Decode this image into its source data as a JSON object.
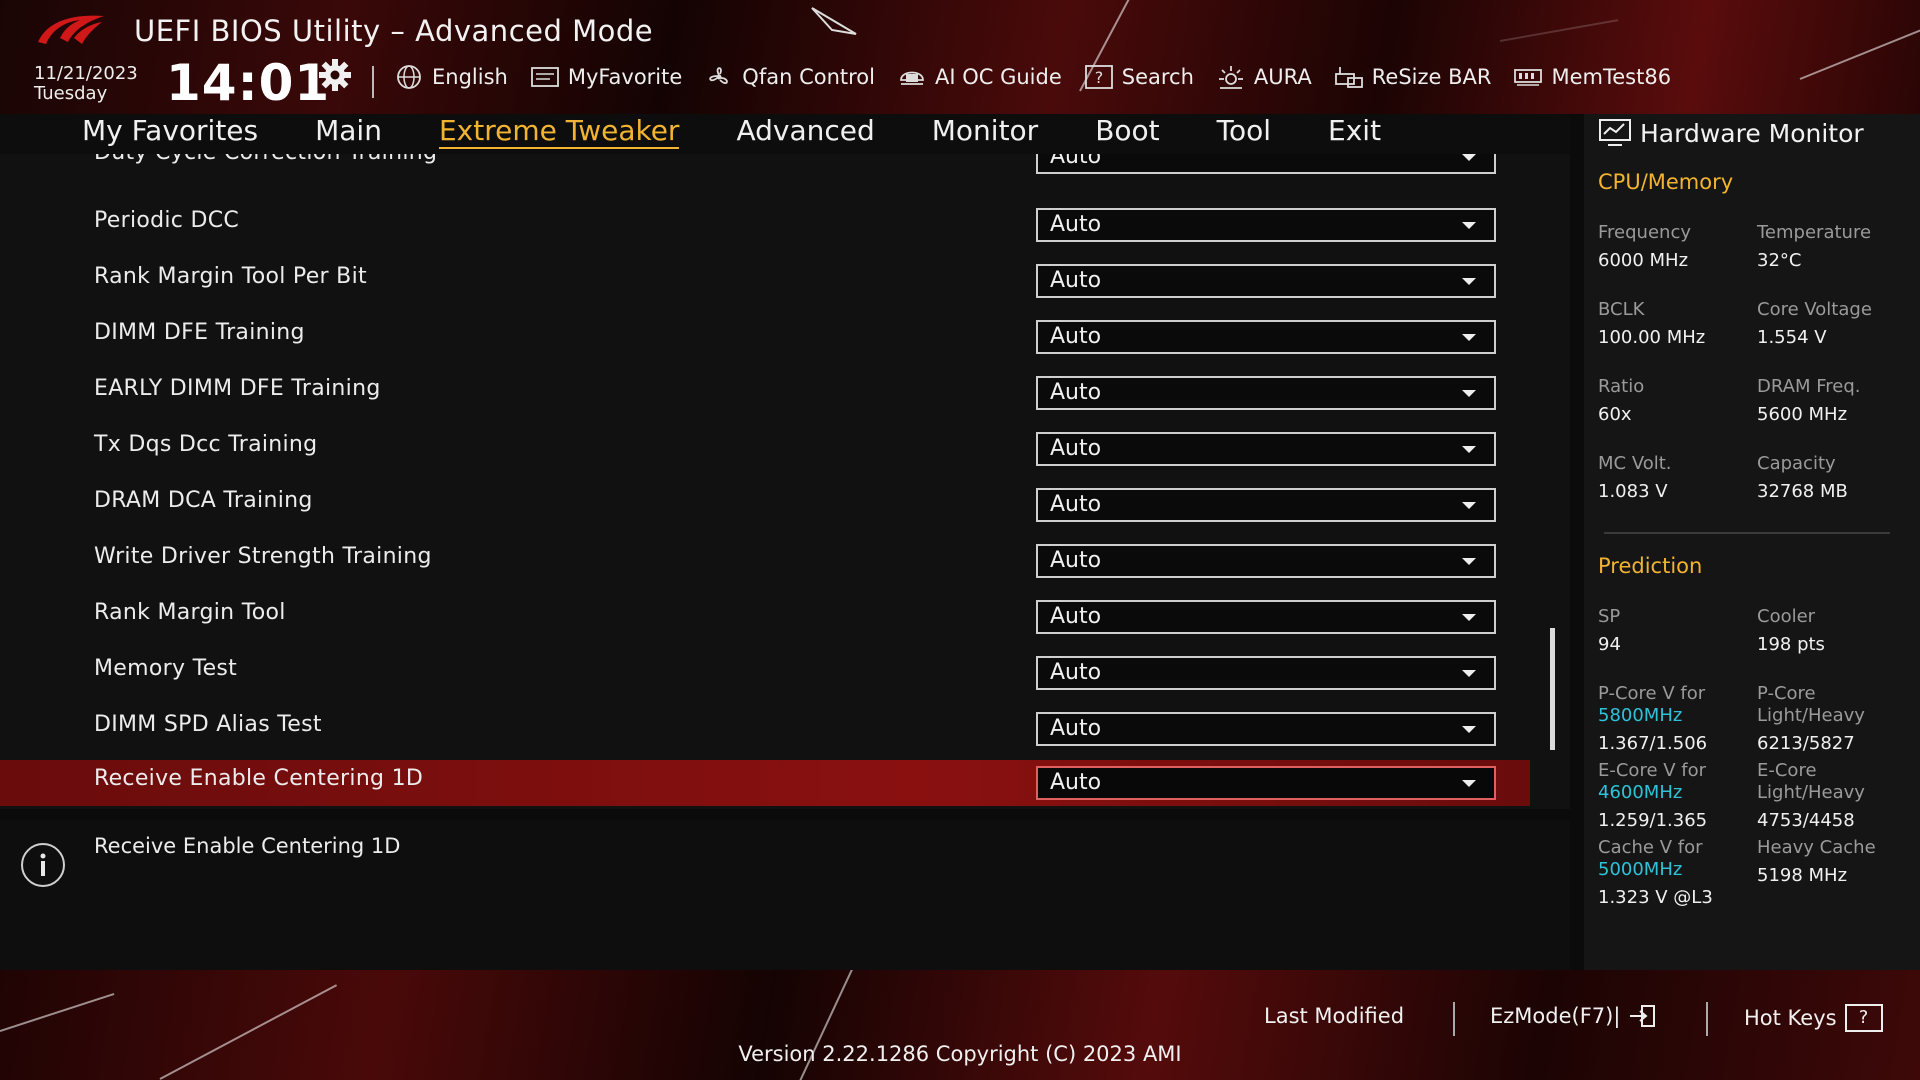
{
  "header": {
    "title": "UEFI BIOS Utility – Advanced Mode",
    "date": "11/21/2023",
    "day": "Tuesday",
    "time": "14:01",
    "tools": [
      {
        "label": "English",
        "icon": "globe-icon"
      },
      {
        "label": "MyFavorite",
        "icon": "favorite-icon"
      },
      {
        "label": "Qfan Control",
        "icon": "fan-icon"
      },
      {
        "label": "AI OC Guide",
        "icon": "ai-icon"
      },
      {
        "label": "Search",
        "icon": "search-icon"
      },
      {
        "label": "AURA",
        "icon": "aura-icon"
      },
      {
        "label": "ReSize BAR",
        "icon": "resize-bar-icon"
      },
      {
        "label": "MemTest86",
        "icon": "memtest-icon"
      }
    ]
  },
  "menu": {
    "tabs": [
      "My Favorites",
      "Main",
      "Extreme Tweaker",
      "Advanced",
      "Monitor",
      "Boot",
      "Tool",
      "Exit"
    ],
    "active": "Extreme Tweaker"
  },
  "settings": {
    "partial_row": {
      "label": "Duty Cycle Correction Training",
      "value": "Auto"
    },
    "rows": [
      {
        "label": "Periodic DCC",
        "value": "Auto"
      },
      {
        "label": "Rank Margin Tool Per Bit",
        "value": "Auto"
      },
      {
        "label": "DIMM DFE Training",
        "value": "Auto"
      },
      {
        "label": "EARLY DIMM DFE Training",
        "value": "Auto"
      },
      {
        "label": "Tx Dqs Dcc Training",
        "value": "Auto"
      },
      {
        "label": "DRAM DCA Training",
        "value": "Auto"
      },
      {
        "label": "Write Driver Strength Training",
        "value": "Auto"
      },
      {
        "label": "Rank Margin Tool",
        "value": "Auto"
      },
      {
        "label": "Memory Test",
        "value": "Auto"
      },
      {
        "label": "DIMM SPD Alias Test",
        "value": "Auto"
      },
      {
        "label": "Receive Enable Centering 1D",
        "value": "Auto"
      }
    ],
    "selected_index": 10
  },
  "info": {
    "text": "Receive Enable Centering 1D"
  },
  "hardware_monitor": {
    "title": "Hardware Monitor",
    "cpu_section": "CPU/Memory",
    "cpu": [
      {
        "k": "Frequency",
        "v": "6000 MHz"
      },
      {
        "k": "Temperature",
        "v": "32°C"
      },
      {
        "k": "BCLK",
        "v": "100.00 MHz"
      },
      {
        "k": "Core Voltage",
        "v": "1.554 V"
      },
      {
        "k": "Ratio",
        "v": "60x"
      },
      {
        "k": "DRAM Freq.",
        "v": "5600 MHz"
      },
      {
        "k": "MC Volt.",
        "v": "1.083 V"
      },
      {
        "k": "Capacity",
        "v": "32768 MB"
      }
    ],
    "prediction_section": "Prediction",
    "sp": {
      "k": "SP",
      "v": "94"
    },
    "cooler": {
      "k": "Cooler",
      "v": "198 pts"
    },
    "pcore_v": {
      "k": "P-Core V for",
      "k2": "5800MHz",
      "v": "1.367/1.506"
    },
    "pcore_lh": {
      "k": "P-Core",
      "k2": "Light/Heavy",
      "v": "6213/5827"
    },
    "ecore_v": {
      "k": "E-Core V for",
      "k2": "4600MHz",
      "v": "1.259/1.365"
    },
    "ecore_lh": {
      "k": "E-Core",
      "k2": "Light/Heavy",
      "v": "4753/4458"
    },
    "cache_v": {
      "k": "Cache V for",
      "k2": "5000MHz",
      "v": "1.323 V @L3"
    },
    "heavy_cache": {
      "k": "Heavy Cache",
      "v": "5198 MHz"
    }
  },
  "footer": {
    "last_modified": "Last Modified",
    "ezmode": "EzMode(F7)|",
    "hotkeys": "Hot Keys",
    "version": "Version 2.22.1286 Copyright (C) 2023 AMI"
  },
  "colors": {
    "accent": "#f2b430",
    "highlight": "#8a1010",
    "cyan": "#2fc2d8"
  }
}
